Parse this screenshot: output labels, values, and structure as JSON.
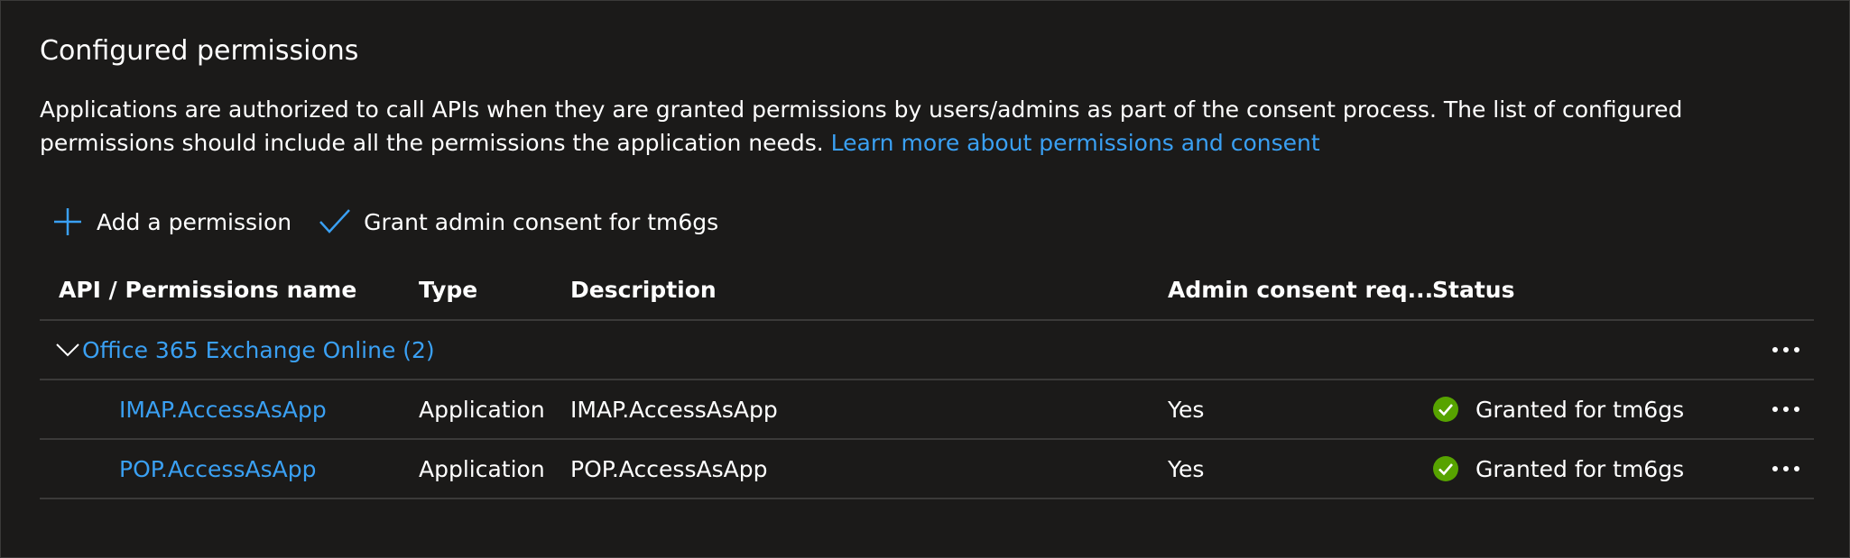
{
  "section": {
    "title": "Configured permissions",
    "description": "Applications are authorized to call APIs when they are granted permissions by users/admins as part of the consent process. The list of configured permissions should include all the permissions the application needs.",
    "learn_more_link": "Learn more about permissions and consent"
  },
  "toolbar": {
    "add_permission_label": "Add a permission",
    "grant_consent_label": "Grant admin consent for tm6gs"
  },
  "table": {
    "columns": [
      "API / Permissions name",
      "Type",
      "Description",
      "Admin consent req...",
      "Status"
    ],
    "group": {
      "label": "Office 365 Exchange Online (2)"
    },
    "rows": [
      {
        "name": "IMAP.AccessAsApp",
        "type": "Application",
        "description": "IMAP.AccessAsApp",
        "admin_consent": "Yes",
        "status": "Granted for tm6gs"
      },
      {
        "name": "POP.AccessAsApp",
        "type": "Application",
        "description": "POP.AccessAsApp",
        "admin_consent": "Yes",
        "status": "Granted for tm6gs"
      }
    ]
  },
  "colors": {
    "background": "#1b1a19",
    "link": "#3aa0f3",
    "divider": "#3b3a39",
    "success": "#57a300"
  },
  "icons": {
    "add": "plus-icon",
    "grant": "checkmark-icon",
    "expand": "chevron-down-icon",
    "status": "check-circle-icon",
    "more": "more-icon"
  }
}
